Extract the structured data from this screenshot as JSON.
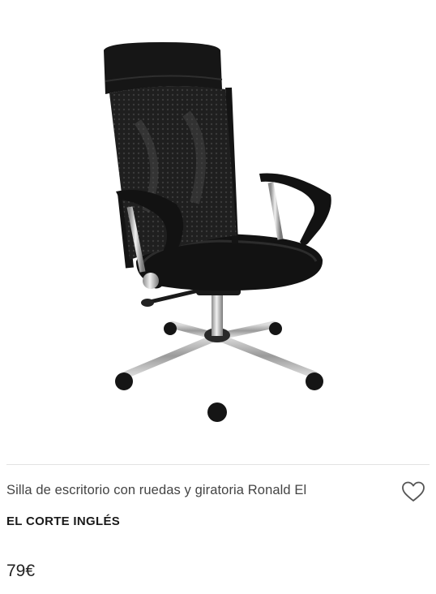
{
  "product": {
    "title": "Silla de escritorio con ruedas y giratoria Ronald El",
    "brand": "EL CORTE INGLÉS",
    "price": "79€",
    "favorite_icon": "heart-outline-icon",
    "image": "office-chair-image"
  },
  "colors": {
    "chair": "#1c1c1c",
    "chrome": "#b9b9b9",
    "divider": "#e3e3e3"
  }
}
